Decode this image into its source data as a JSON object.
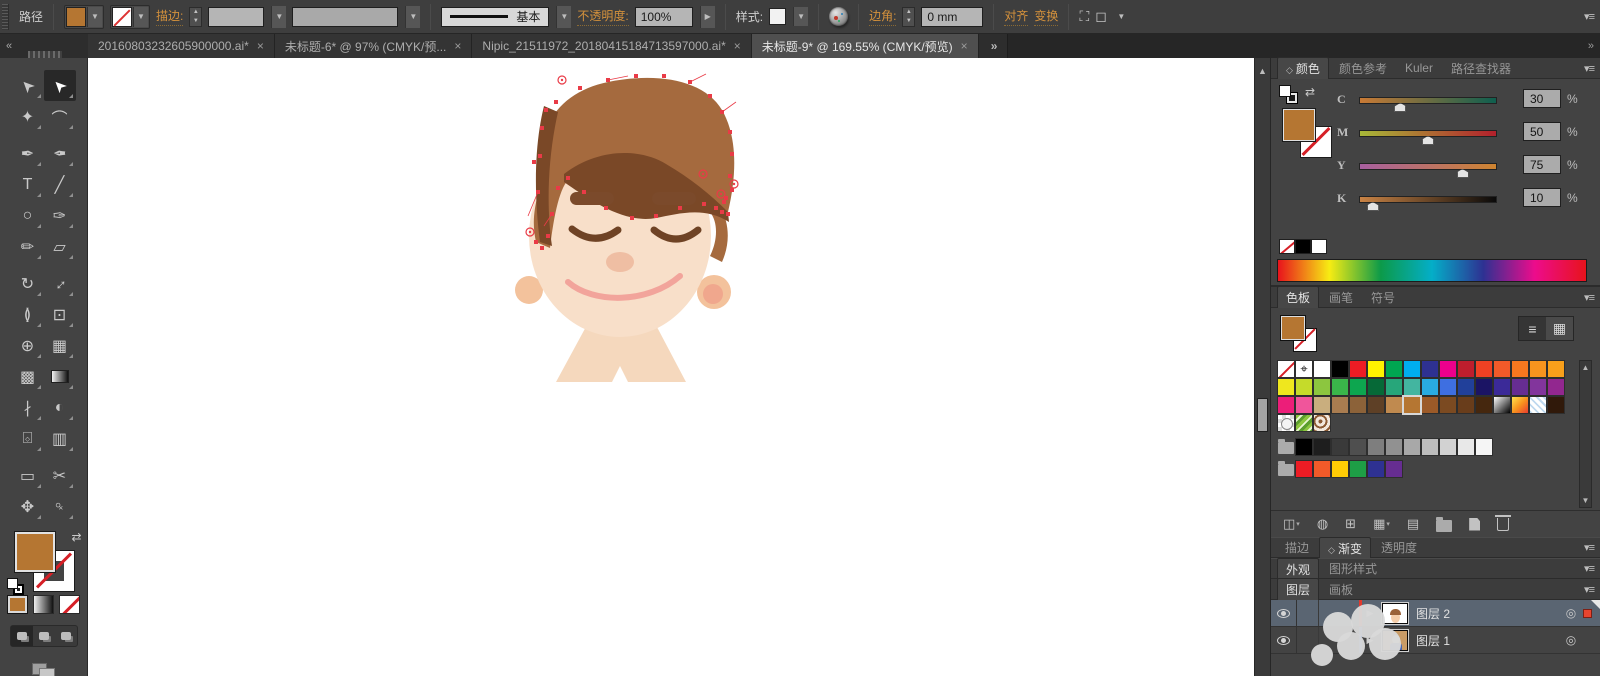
{
  "control_bar": {
    "context_label": "路径",
    "fill_color": "#B57632",
    "stroke_label": "描边:",
    "stroke_weight_value": "",
    "variable_width_value": "",
    "brush_definition": "基本",
    "opacity_label": "不透明度:",
    "opacity_value": "100%",
    "style_label": "样式:",
    "corner_label": "边角:",
    "corner_value": "0 mm",
    "align_label": "对齐",
    "transform_label": "变换",
    "menu_glyph": "▾≡"
  },
  "tab_bar": {
    "collapse_left_glyph": "«",
    "overflow_glyph": "»",
    "dock_collapse_glyph": "»",
    "close_glyph": "×",
    "tabs": [
      {
        "label": "20160803232605900000.ai*",
        "active": false
      },
      {
        "label": "未标题-6* @ 97% (CMYK/预...",
        "active": false
      },
      {
        "label": "Nipic_21511972_20180415184713597000.ai*",
        "active": false
      },
      {
        "label": "未标题-9* @ 169.55% (CMYK/预览)",
        "active": true
      }
    ]
  },
  "tools": [
    {
      "n": "selection-tool",
      "g": "➤"
    },
    {
      "n": "direct-selection-tool",
      "g": "➤",
      "active": true
    },
    {
      "n": "magic-wand-tool",
      "g": "✦"
    },
    {
      "n": "lasso-tool",
      "g": "⌒"
    },
    {
      "n": "gap"
    },
    {
      "n": "pen-tool",
      "g": "✒"
    },
    {
      "n": "curvature-pen-tool",
      "g": "✒"
    },
    {
      "n": "type-tool",
      "g": "T"
    },
    {
      "n": "line-segment-tool",
      "g": "╱"
    },
    {
      "n": "ellipse-tool",
      "g": "○"
    },
    {
      "n": "paintbrush-tool",
      "g": "✑"
    },
    {
      "n": "pencil-tool",
      "g": "✏"
    },
    {
      "n": "eraser-tool",
      "g": "▱"
    },
    {
      "n": "gap"
    },
    {
      "n": "rotate-tool",
      "g": "↻"
    },
    {
      "n": "scale-tool",
      "g": "↔"
    },
    {
      "n": "width-tool",
      "g": "≬"
    },
    {
      "n": "free-transform-tool",
      "g": "⊡"
    },
    {
      "n": "shape-builder-tool",
      "g": "⊕"
    },
    {
      "n": "perspective-grid-tool",
      "g": "▦"
    },
    {
      "n": "mesh-tool",
      "g": "▩"
    },
    {
      "n": "gradient-tool",
      "g": ""
    },
    {
      "n": "eyedropper-tool",
      "g": "∤"
    },
    {
      "n": "blend-tool",
      "g": "◐"
    },
    {
      "n": "symbol-sprayer-tool",
      "g": "⌺"
    },
    {
      "n": "column-graph-tool",
      "g": "▥"
    },
    {
      "n": "gap"
    },
    {
      "n": "artboard-tool",
      "g": "▭"
    },
    {
      "n": "slice-tool",
      "g": "✂"
    },
    {
      "n": "hand-tool",
      "g": "✥"
    },
    {
      "n": "zoom-tool",
      "g": "♀"
    }
  ],
  "color_panel": {
    "tabs": [
      {
        "label": "颜色",
        "active": true,
        "toggle": "◇"
      },
      {
        "label": "颜色参考"
      },
      {
        "label": "Kuler"
      },
      {
        "label": "路径查找器"
      }
    ],
    "sliders": [
      {
        "channel": "C",
        "value": "30",
        "pct": 30,
        "from": "#C97A35",
        "to": "#0F5F4F"
      },
      {
        "channel": "M",
        "value": "50",
        "pct": 50,
        "from": "#A8B838",
        "to": "#B3202C"
      },
      {
        "channel": "Y",
        "value": "75",
        "pct": 75,
        "from": "#A85FA0",
        "to": "#CE8430"
      },
      {
        "channel": "K",
        "value": "10",
        "pct": 10,
        "from": "#C98345",
        "to": "#0A0A0A"
      }
    ],
    "unit": "%",
    "spectrum": [
      "#E8131C",
      "#F7EC13",
      "#0C9A49",
      "#04AEC8",
      "#2E3192",
      "#EC0C8C",
      "#E8131C"
    ]
  },
  "swatches_panel": {
    "tabs": [
      {
        "label": "色板",
        "active": true
      },
      {
        "label": "画笔"
      },
      {
        "label": "符号"
      }
    ],
    "rows": [
      [
        {
          "t": "none"
        },
        {
          "t": "reg"
        },
        {
          "t": "c",
          "c": "#FFFFFF"
        },
        {
          "t": "c",
          "c": "#000000"
        },
        {
          "t": "c",
          "c": "#ED1C24"
        },
        {
          "t": "c",
          "c": "#FFF200"
        },
        {
          "t": "c",
          "c": "#00A651"
        },
        {
          "t": "c",
          "c": "#00AEEF"
        },
        {
          "t": "c",
          "c": "#2E3192"
        },
        {
          "t": "c",
          "c": "#EC008C"
        },
        {
          "t": "c",
          "c": "#BE1E2D"
        },
        {
          "t": "c",
          "c": "#EF4123"
        },
        {
          "t": "c",
          "c": "#F15A29"
        },
        {
          "t": "c",
          "c": "#F7781F"
        },
        {
          "t": "c",
          "c": "#F7941E"
        },
        {
          "t": "c",
          "c": "#F9A01B"
        }
      ],
      [
        {
          "t": "c",
          "c": "#EFE71E"
        },
        {
          "t": "c",
          "c": "#C5DB2A"
        },
        {
          "t": "c",
          "c": "#8CC63F"
        },
        {
          "t": "c",
          "c": "#3AB54A"
        },
        {
          "t": "c",
          "c": "#0DA64F"
        },
        {
          "t": "c",
          "c": "#066937"
        },
        {
          "t": "c",
          "c": "#27A67A"
        },
        {
          "t": "c",
          "c": "#43B5A0"
        },
        {
          "t": "c",
          "c": "#29ABE2"
        },
        {
          "t": "c",
          "c": "#3E6FE1"
        },
        {
          "t": "c",
          "c": "#21409A"
        },
        {
          "t": "c",
          "c": "#1B1464"
        },
        {
          "t": "c",
          "c": "#3B2A98"
        },
        {
          "t": "c",
          "c": "#662D91"
        },
        {
          "t": "c",
          "c": "#82359C"
        },
        {
          "t": "c",
          "c": "#92278F"
        }
      ],
      [
        {
          "t": "c",
          "c": "#EC1E79"
        },
        {
          "t": "c",
          "c": "#F0559B"
        },
        {
          "t": "c",
          "c": "#C9AE7E"
        },
        {
          "t": "c",
          "c": "#A97C50"
        },
        {
          "t": "c",
          "c": "#8C6239"
        },
        {
          "t": "c",
          "c": "#5E4026"
        },
        {
          "t": "c",
          "c": "#C08A4F"
        },
        {
          "t": "c",
          "c": "#B57632",
          "sel": true
        },
        {
          "t": "c",
          "c": "#9C5A28"
        },
        {
          "t": "c",
          "c": "#7B4A21"
        },
        {
          "t": "c",
          "c": "#693D1B"
        },
        {
          "t": "c",
          "c": "#45270E"
        },
        {
          "t": "g",
          "c": "linear-gradient(135deg,#ffffff,#000000)"
        },
        {
          "t": "g",
          "c": "linear-gradient(135deg,#FFE34D,#F7941E,#E93C2F)"
        },
        {
          "t": "hatch"
        },
        {
          "t": "c",
          "c": "#30190A"
        }
      ],
      [
        {
          "t": "dotpat"
        },
        {
          "t": "greenpat"
        },
        {
          "t": "floralpat"
        }
      ],
      [
        {
          "t": "folder"
        },
        {
          "t": "c",
          "c": "#000000"
        },
        {
          "t": "c",
          "c": "#1E1E1E"
        },
        {
          "t": "c",
          "c": "#3A3A3A"
        },
        {
          "t": "c",
          "c": "#4F4F4F"
        },
        {
          "t": "c",
          "c": "#7E7E7E"
        },
        {
          "t": "c",
          "c": "#919191"
        },
        {
          "t": "c",
          "c": "#A8A8A8"
        },
        {
          "t": "c",
          "c": "#BCBCBC"
        },
        {
          "t": "c",
          "c": "#D2D2D2"
        },
        {
          "t": "c",
          "c": "#E8E8E8"
        },
        {
          "t": "c",
          "c": "#F5F5F5"
        }
      ],
      [
        {
          "t": "folder"
        },
        {
          "t": "c",
          "c": "#ED1C24"
        },
        {
          "t": "c",
          "c": "#F15A29"
        },
        {
          "t": "c",
          "c": "#FFCB05"
        },
        {
          "t": "c",
          "c": "#1E9E46"
        },
        {
          "t": "c",
          "c": "#2E3192"
        },
        {
          "t": "c",
          "c": "#662D91"
        }
      ]
    ],
    "bottom_icons": [
      {
        "n": "swatch-libraries-menu-icon",
        "t": "glyph",
        "g": "◫",
        "dd": true
      },
      {
        "n": "color-themes-icon",
        "t": "glyph",
        "g": "◍"
      },
      {
        "n": "swatch-kinds-menu-icon",
        "t": "glyph",
        "g": "⊞"
      },
      {
        "n": "list-view-menu-icon",
        "t": "glyph",
        "g": "▦",
        "dd": true
      },
      {
        "n": "swatch-options-icon",
        "t": "glyph",
        "g": "▤"
      },
      {
        "n": "new-color-group-icon",
        "t": "folder"
      },
      {
        "n": "new-swatch-icon",
        "t": "new"
      },
      {
        "n": "delete-swatch-icon",
        "t": "trash"
      }
    ]
  },
  "panel_strips": [
    {
      "name": "stroke-gradient-transparency",
      "tabs": [
        {
          "label": "描边"
        },
        {
          "label": "渐变",
          "active": true,
          "toggle": "◇"
        },
        {
          "label": "透明度"
        }
      ]
    },
    {
      "name": "appearance-graphic-styles",
      "tabs": [
        {
          "label": "外观",
          "active": true
        },
        {
          "label": "图形样式"
        }
      ]
    }
  ],
  "layers_panel": {
    "tabs": [
      {
        "label": "图层",
        "active": true
      },
      {
        "label": "画板"
      }
    ],
    "expand_glyph": "▶",
    "target_glyph": "◎",
    "layers": [
      {
        "name": "图层 2",
        "selected": true,
        "stripe": "#E23A2E",
        "thumb": "face"
      },
      {
        "name": "图层 1",
        "selected": false,
        "stripe": "#3A5FCD",
        "thumb": "photo"
      }
    ]
  },
  "artwork": {
    "hair": "#A56A3E",
    "hair_shadow": "#7A4827",
    "skin": "#F8DFC9",
    "neck": "#F5D8BD",
    "ear": "#F3C29C",
    "blush": "#F0A78D",
    "brow": "#7B4A2B",
    "eye": "#6F4325",
    "nose": "#EFBEA3",
    "smile": "#F2A49B",
    "anchor": "#E93B47"
  }
}
